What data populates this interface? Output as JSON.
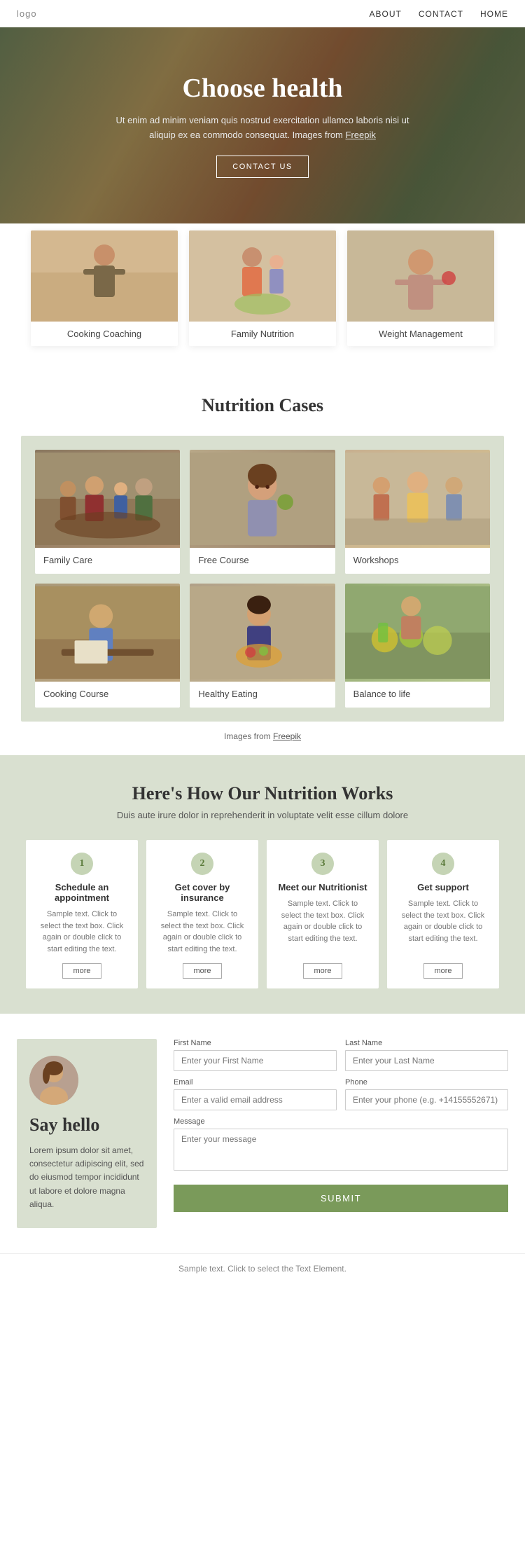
{
  "nav": {
    "logo": "logo",
    "links": [
      {
        "label": "ABOUT",
        "href": "#"
      },
      {
        "label": "CONTACT",
        "href": "#"
      },
      {
        "label": "HOME",
        "href": "#"
      }
    ]
  },
  "hero": {
    "title": "Choose health",
    "description": "Ut enim ad minim veniam quis nostrud exercitation ullamco laboris nisi ut aliquip ex ea commodo consequat. Images from",
    "freepik_label": "Freepik",
    "cta_label": "CONTACT US"
  },
  "services": {
    "cards": [
      {
        "label": "Cooking Coaching"
      },
      {
        "label": "Family Nutrition"
      },
      {
        "label": "Weight Management"
      }
    ]
  },
  "cases": {
    "title": "Nutrition Cases",
    "items": [
      {
        "label": "Family Care"
      },
      {
        "label": "Free Course"
      },
      {
        "label": "Workshops"
      },
      {
        "label": "Cooking Course"
      },
      {
        "label": "Healthy Eating"
      },
      {
        "label": "Balance to life"
      }
    ],
    "attribution": "Images from",
    "freepik_label": "Freepik"
  },
  "how": {
    "title": "Here's How Our Nutrition Works",
    "subtitle": "Duis aute irure dolor in reprehenderit in voluptate velit esse cillum dolore",
    "steps": [
      {
        "number": "1",
        "title": "Schedule an appointment",
        "description": "Sample text. Click to select the text box. Click again or double click to start editing the text.",
        "more_label": "more"
      },
      {
        "number": "2",
        "title": "Get cover by insurance",
        "description": "Sample text. Click to select the text box. Click again or double click to start editing the text.",
        "more_label": "more"
      },
      {
        "number": "3",
        "title": "Meet our Nutritionist",
        "description": "Sample text. Click to select the text box. Click again or double click to start editing the text.",
        "more_label": "more"
      },
      {
        "number": "4",
        "title": "Get support",
        "description": "Sample text. Click to select the text box. Click again or double click to start editing the text.",
        "more_label": "more"
      }
    ]
  },
  "contact": {
    "greeting": "Say hello",
    "description": "Lorem ipsum dolor sit amet, consectetur adipiscing elit, sed do eiusmod tempor incididunt ut labore et dolore magna aliqua.",
    "form": {
      "first_name_label": "First Name",
      "first_name_placeholder": "Enter your First Name",
      "last_name_label": "Last Name",
      "last_name_placeholder": "Enter your Last Name",
      "email_label": "Email",
      "email_placeholder": "Enter a valid email address",
      "phone_label": "Phone",
      "phone_placeholder": "Enter your phone (e.g. +14155552671)",
      "message_label": "Message",
      "message_placeholder": "Enter your message",
      "submit_label": "SUBMIT"
    }
  },
  "footer": {
    "sample_text": "Sample text. Click to select the Text Element."
  }
}
